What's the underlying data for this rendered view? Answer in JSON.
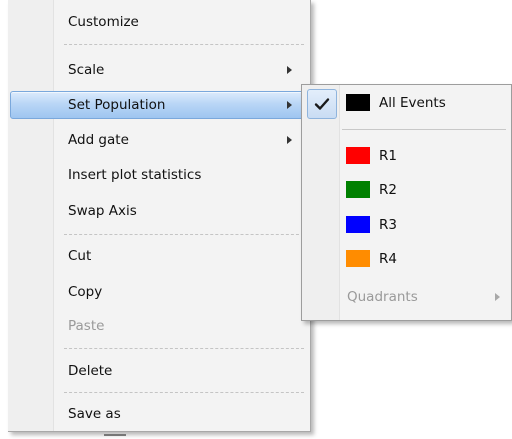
{
  "context_menu": {
    "items": [
      {
        "label": "Customize"
      },
      {
        "label": "Scale"
      },
      {
        "label": "Set Population"
      },
      {
        "label": "Add gate"
      },
      {
        "label": "Insert plot statistics"
      },
      {
        "label": "Swap Axis"
      },
      {
        "label": "Cut"
      },
      {
        "label": "Copy"
      },
      {
        "label": "Paste"
      },
      {
        "label": "Delete"
      },
      {
        "label": "Save as"
      }
    ],
    "highlighted_item": "Set Population",
    "highlight_color": "#b9d6f6"
  },
  "population_submenu": {
    "items": [
      {
        "label": "All Events",
        "swatch_color": "#000000",
        "checked": true
      },
      {
        "label": "R1",
        "swatch_color": "#ff0000",
        "checked": false
      },
      {
        "label": "R2",
        "swatch_color": "#008000",
        "checked": false
      },
      {
        "label": "R3",
        "swatch_color": "#0000ff",
        "checked": false
      },
      {
        "label": "R4",
        "swatch_color": "#ff8c00",
        "checked": false
      }
    ],
    "quadrants_label": "Quadrants"
  }
}
